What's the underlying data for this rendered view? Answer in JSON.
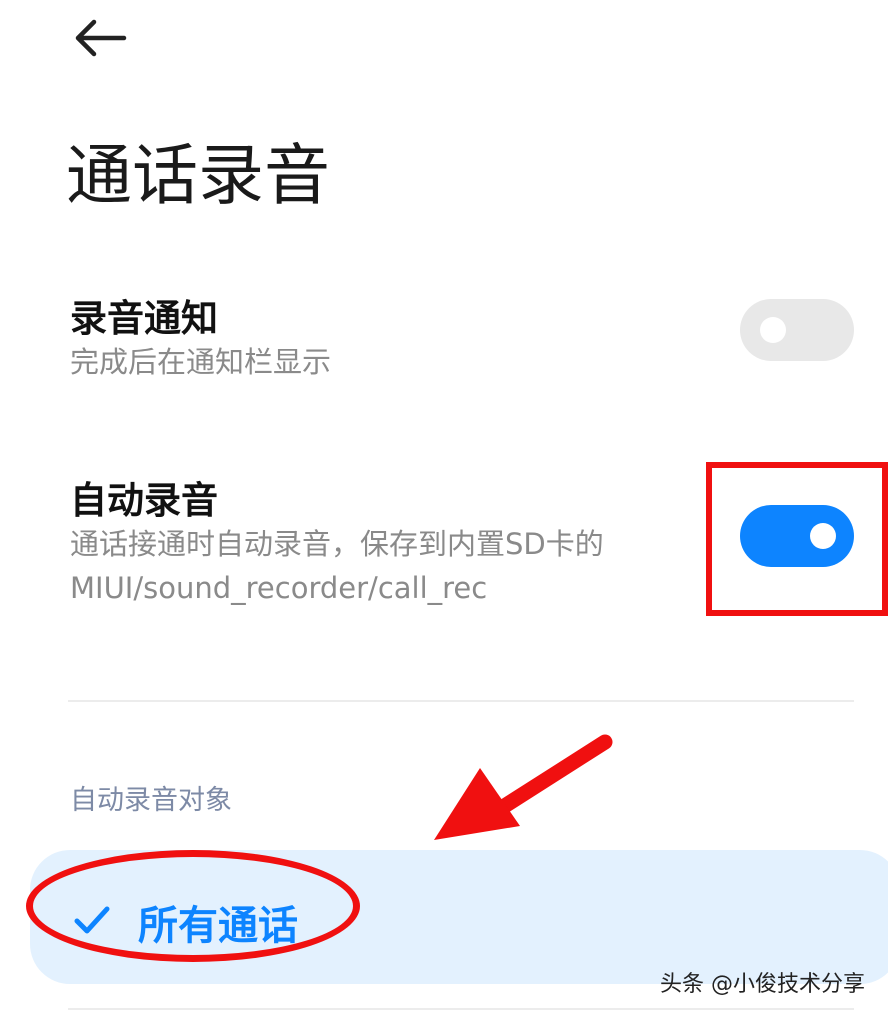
{
  "header": {
    "back_icon": "arrow-left-icon",
    "title": "通话录音"
  },
  "settings": {
    "notify": {
      "title": "录音通知",
      "subtitle": "完成后在通知栏显示",
      "enabled": false
    },
    "auto_record": {
      "title": "自动录音",
      "subtitle_line1": "通话接通时自动录音，保存到内置SD卡的",
      "subtitle_line2": "MIUI/sound_recorder/call_rec",
      "enabled": true
    }
  },
  "auto_record_target": {
    "label": "自动录音对象",
    "selected": "所有通话",
    "check_icon": "checkmark-icon"
  },
  "annotations": {
    "color": "#f01010"
  },
  "colors": {
    "accent": "#0d84ff",
    "selected_bg": "#e3f1fe"
  },
  "watermark": "头条 @小俊技术分享"
}
